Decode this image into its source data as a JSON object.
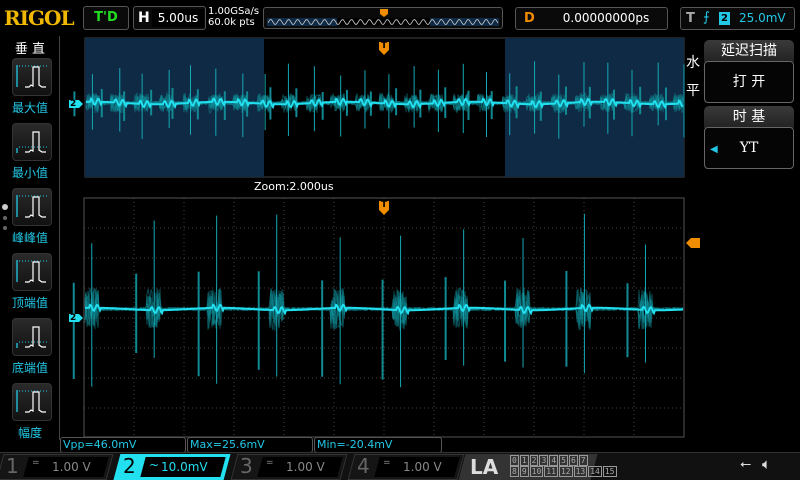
{
  "header": {
    "brand": "RIGOL",
    "run_status": "T'D",
    "horizontal": {
      "key": "H",
      "timebase": "5.00us"
    },
    "sample_rate": "1.00GSa/s",
    "memory_depth": "60.0k pts",
    "delay": {
      "key": "D",
      "value": "0.00000000ps"
    },
    "trigger": {
      "key": "T",
      "edge": "rising-edge-icon",
      "source": "2",
      "level": "25.0mV"
    }
  },
  "left_menu": {
    "title": "垂 直",
    "items": [
      {
        "label": "最大值"
      },
      {
        "label": "最小值"
      },
      {
        "label": "峰峰值"
      },
      {
        "label": "顶端值"
      },
      {
        "label": "底端值"
      },
      {
        "label": "幅度"
      }
    ]
  },
  "right_menu": {
    "side_title": [
      "水",
      "平"
    ],
    "items": [
      {
        "title": "延迟扫描",
        "value": "打 开"
      },
      {
        "title": "时 基",
        "value": "YT"
      }
    ]
  },
  "zoom_label": "Zoom:2.000us",
  "channel_marker": "2",
  "trigger_marker": "T",
  "measurements": [
    {
      "text": "Vpp=46.0mV"
    },
    {
      "text": "Max=25.6mV"
    },
    {
      "text": "Min=-20.4mV"
    }
  ],
  "channels": [
    {
      "num": "1",
      "coupling": "=",
      "scale": "1.00 V",
      "color": "#c8c800",
      "active": false
    },
    {
      "num": "2",
      "coupling": "~",
      "scale": "10.0mV",
      "color": "#22e0f0",
      "active": true
    },
    {
      "num": "3",
      "coupling": "=",
      "scale": "1.00 V",
      "color": "#c800c8",
      "active": false
    },
    {
      "num": "4",
      "coupling": "=",
      "scale": "1.00 V",
      "color": "#2060ff",
      "active": false
    }
  ],
  "la": {
    "label": "LA",
    "bits_row1": [
      "0",
      "1",
      "2",
      "3",
      "4",
      "5",
      "6",
      "7"
    ],
    "bits_row2": [
      "8",
      "9",
      "10",
      "11",
      "12",
      "13",
      "14",
      "15"
    ]
  },
  "colors": {
    "trace": "#22e0f0",
    "trigger": "#f08c00",
    "zoom_window": "#0f2a44"
  }
}
